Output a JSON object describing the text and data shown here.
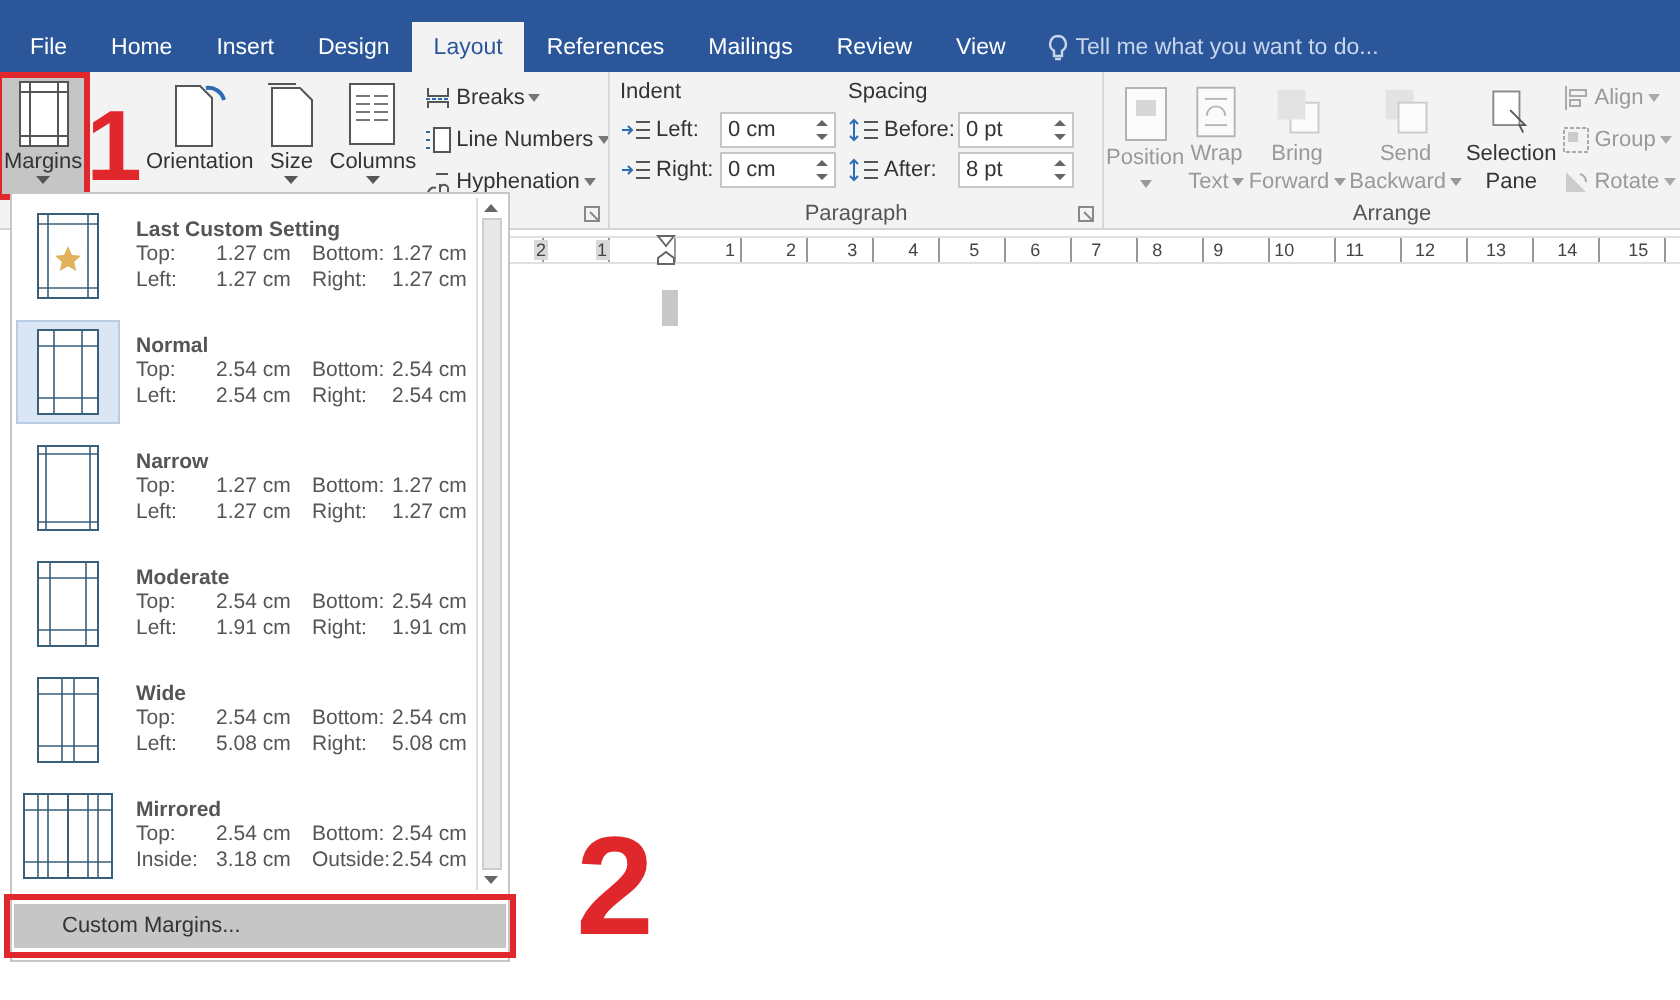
{
  "tabs": [
    {
      "label": "File",
      "selected": false
    },
    {
      "label": "Home",
      "selected": false
    },
    {
      "label": "Insert",
      "selected": false
    },
    {
      "label": "Design",
      "selected": false
    },
    {
      "label": "Layout",
      "selected": true
    },
    {
      "label": "References",
      "selected": false
    },
    {
      "label": "Mailings",
      "selected": false
    },
    {
      "label": "Review",
      "selected": false
    },
    {
      "label": "View",
      "selected": false
    }
  ],
  "tell_me": {
    "placeholder": "Tell me what you want to do..."
  },
  "page_setup": {
    "large_buttons": [
      {
        "kind": "margins",
        "label": "Margins",
        "caret": true,
        "pressed": true,
        "highlighted": true
      },
      {
        "kind": "orientation",
        "label": "Orientation",
        "caret": false,
        "pressed": false,
        "highlighted": false
      },
      {
        "kind": "size",
        "label": "Size",
        "caret": true,
        "pressed": false,
        "highlighted": false
      },
      {
        "kind": "columns",
        "label": "Columns",
        "caret": true,
        "pressed": false,
        "highlighted": false
      }
    ],
    "small_buttons": [
      {
        "kind": "breaks",
        "label": "Breaks"
      },
      {
        "kind": "line-numbers",
        "label": "Line Numbers"
      },
      {
        "kind": "hyphenation",
        "label": "Hyphenation"
      }
    ]
  },
  "paragraph": {
    "title": "Paragraph",
    "columns": [
      {
        "kind": "indent",
        "heading": "Indent",
        "fields": [
          {
            "label": "Left:",
            "value": "0 cm"
          },
          {
            "label": "Right:",
            "value": "0 cm"
          }
        ]
      },
      {
        "kind": "spacing",
        "heading": "Spacing",
        "fields": [
          {
            "label": "Before:",
            "value": "0 pt"
          },
          {
            "label": "After:",
            "value": "8 pt"
          }
        ]
      }
    ]
  },
  "arrange": {
    "title": "Arrange",
    "large_buttons": [
      {
        "kind": "position",
        "lines": [
          "Position"
        ],
        "caret": true,
        "disabled": true
      },
      {
        "kind": "wrap",
        "lines": [
          "Wrap",
          "Text"
        ],
        "caret": true,
        "disabled": true
      },
      {
        "kind": "forward",
        "lines": [
          "Bring",
          "Forward"
        ],
        "caret": true,
        "disabled": true
      },
      {
        "kind": "backward",
        "lines": [
          "Send",
          "Backward"
        ],
        "caret": true,
        "disabled": true
      },
      {
        "kind": "selection",
        "lines": [
          "Selection",
          "Pane"
        ],
        "caret": false,
        "disabled": false
      }
    ],
    "small_buttons": [
      {
        "kind": "align",
        "label": "Align",
        "disabled": true
      },
      {
        "kind": "group",
        "label": "Group",
        "disabled": true
      },
      {
        "kind": "rotate",
        "label": "Rotate",
        "disabled": true
      }
    ]
  },
  "ruler": {
    "left_numbers": [
      "2",
      "1"
    ],
    "numbers": [
      "1",
      "2",
      "3",
      "4",
      "5",
      "6",
      "7",
      "8",
      "9",
      "10",
      "11",
      "12",
      "13",
      "14",
      "15"
    ]
  },
  "margins_menu": {
    "presets": [
      {
        "kind": "custom",
        "name": "Last Custom Setting",
        "selected": false,
        "rows": [
          {
            "label": "Top:",
            "value": "1.27 cm",
            "label2": "Bottom:",
            "value2": "1.27 cm"
          },
          {
            "label": "Left:",
            "value": "1.27 cm",
            "label2": "Right:",
            "value2": "1.27 cm"
          }
        ]
      },
      {
        "kind": "normal",
        "name": "Normal",
        "selected": true,
        "rows": [
          {
            "label": "Top:",
            "value": "2.54 cm",
            "label2": "Bottom:",
            "value2": "2.54 cm"
          },
          {
            "label": "Left:",
            "value": "2.54 cm",
            "label2": "Right:",
            "value2": "2.54 cm"
          }
        ]
      },
      {
        "kind": "narrow",
        "name": "Narrow",
        "selected": false,
        "rows": [
          {
            "label": "Top:",
            "value": "1.27 cm",
            "label2": "Bottom:",
            "value2": "1.27 cm"
          },
          {
            "label": "Left:",
            "value": "1.27 cm",
            "label2": "Right:",
            "value2": "1.27 cm"
          }
        ]
      },
      {
        "kind": "moderate",
        "name": "Moderate",
        "selected": false,
        "rows": [
          {
            "label": "Top:",
            "value": "2.54 cm",
            "label2": "Bottom:",
            "value2": "2.54 cm"
          },
          {
            "label": "Left:",
            "value": "1.91 cm",
            "label2": "Right:",
            "value2": "1.91 cm"
          }
        ]
      },
      {
        "kind": "wide",
        "name": "Wide",
        "selected": false,
        "rows": [
          {
            "label": "Top:",
            "value": "2.54 cm",
            "label2": "Bottom:",
            "value2": "2.54 cm"
          },
          {
            "label": "Left:",
            "value": "5.08 cm",
            "label2": "Right:",
            "value2": "5.08 cm"
          }
        ]
      },
      {
        "kind": "mirrored",
        "name": "Mirrored",
        "selected": false,
        "rows": [
          {
            "label": "Top:",
            "value": "2.54 cm",
            "label2": "Bottom:",
            "value2": "2.54 cm"
          },
          {
            "label": "Inside:",
            "value": "3.18 cm",
            "label2": "Outside:",
            "value2": "2.54 cm"
          }
        ]
      }
    ],
    "custom_margins": {
      "label": "Custom Margins...",
      "highlighted": true
    }
  },
  "annotations": [
    {
      "text": "1"
    },
    {
      "text": "2"
    }
  ]
}
